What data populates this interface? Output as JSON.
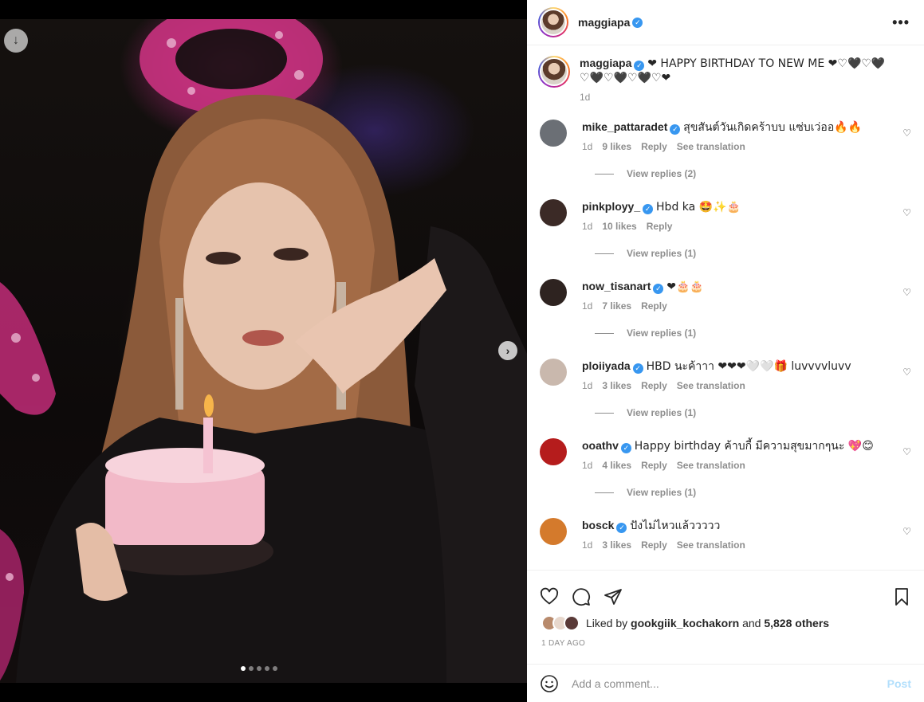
{
  "post": {
    "author": "maggiapa",
    "slide_count": 5,
    "active_slide": 1
  },
  "caption": {
    "username": "maggiapa",
    "text_prefix": "❤ HAPPY BIRTHDAY TO NEW ME ❤♡🖤♡🖤",
    "text_line2": "♡🖤♡🖤♡🖤♡❤",
    "time": "1d"
  },
  "comments": [
    {
      "username": "mike_pattaradet",
      "text": "สุขสันต์วันเกิดคร้าบบ แซ่บเว่ออ🔥🔥",
      "time": "1d",
      "likes": "9 likes",
      "reply": "Reply",
      "translate": "See translation",
      "replies": "View replies (2)",
      "avatar_color": "#6b6f75"
    },
    {
      "username": "pinkployy_",
      "text": "Hbd ka 🤩✨🎂",
      "time": "1d",
      "likes": "10 likes",
      "reply": "Reply",
      "translate": "",
      "replies": "View replies (1)",
      "avatar_color": "#3b2a26"
    },
    {
      "username": "now_tisanart",
      "text": "❤🎂🎂",
      "time": "1d",
      "likes": "7 likes",
      "reply": "Reply",
      "translate": "",
      "replies": "View replies (1)",
      "avatar_color": "#2e2320"
    },
    {
      "username": "ploiiyada",
      "text": "HBD นะค้าาา ❤❤❤🤍🤍🎁 luvvvvluvv",
      "time": "1d",
      "likes": "3 likes",
      "reply": "Reply",
      "translate": "See translation",
      "replies": "View replies (1)",
      "avatar_color": "#c9b8ad"
    },
    {
      "username": "ooathv",
      "text": "Happy birthday ค้าบกี้ มีความสุขมากๆนะ 💖😊",
      "time": "1d",
      "likes": "4 likes",
      "reply": "Reply",
      "translate": "See translation",
      "replies": "View replies (1)",
      "avatar_color": "#b51c1c"
    },
    {
      "username": "bosck",
      "text": "ปังไม่ไหวแล้ววววว",
      "time": "1d",
      "likes": "3 likes",
      "reply": "Reply",
      "translate": "See translation",
      "replies": "",
      "avatar_color": "#d47a2c"
    }
  ],
  "likes": {
    "prefix": "Liked by",
    "user": "gookgiik_kochakorn",
    "and": "and",
    "others": "5,828 others"
  },
  "time_ago": "1 DAY AGO",
  "add_comment": {
    "placeholder": "Add a comment...",
    "post_label": "Post"
  },
  "icons": {
    "download": "download-icon",
    "next": "chevron-right-icon",
    "more": "more-options-icon",
    "like": "heart-icon",
    "comment": "comment-icon",
    "share": "share-icon",
    "save": "bookmark-icon",
    "emoji": "emoji-icon"
  },
  "colors": {
    "verified": "#3897f0",
    "like_red": "#ed2b48",
    "post_disabled": "#b2dffc",
    "muted": "#8e8e8e"
  }
}
